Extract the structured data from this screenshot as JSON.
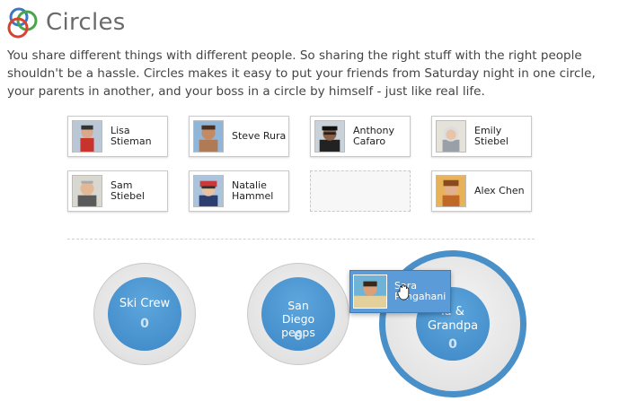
{
  "header": {
    "title": "Circles",
    "logo_icon": "circles-logo-icon"
  },
  "intro": "You share different things with different people. So sharing the right stuff with the right people shouldn't be a hassle. Circles makes it easy to put your friends from Saturday night in one circle, your parents in another, and your boss in a circle by himself - just like real life.",
  "people": [
    {
      "name": "Lisa Stieman"
    },
    {
      "name": "Steve Rura"
    },
    {
      "name": "Anthony Cafaro"
    },
    {
      "name": "Emily Stiebel"
    },
    {
      "name": "Sam Stiebel"
    },
    {
      "name": "Natalie Hammel"
    },
    {
      "name": "Alex Chen"
    }
  ],
  "dragged_person": {
    "name": "Sara Pangahani"
  },
  "circles": [
    {
      "name": "Ski Crew",
      "count": "0"
    },
    {
      "name": "San Diego peeps",
      "count": "0"
    },
    {
      "name": "Grandma & Grandpa",
      "visible_name": "ia &\nGrandpa",
      "count": "0"
    }
  ],
  "colors": {
    "circle_blue": "#3d87c7",
    "ring_blue": "#4a90c8",
    "logo_blue": "#3b78c7",
    "logo_red": "#d8422e",
    "logo_green": "#4aa54a"
  }
}
